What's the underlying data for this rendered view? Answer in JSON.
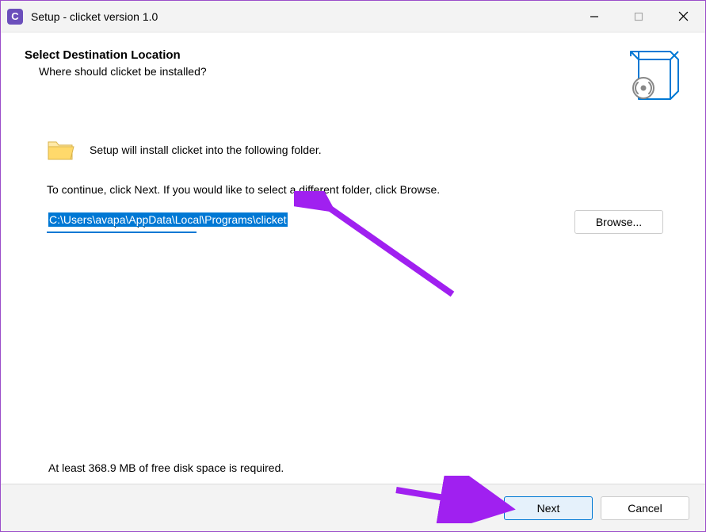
{
  "titlebar": {
    "icon_letter": "C",
    "title": "Setup - clicket version 1.0"
  },
  "header": {
    "title": "Select Destination Location",
    "subtitle": "Where should clicket be installed?"
  },
  "main": {
    "install_line": "Setup will install clicket into the following folder.",
    "continue_line": "To continue, click Next. If you would like to select a different folder, click Browse.",
    "path_value": "C:\\Users\\avapa\\AppData\\Local\\Programs\\clicket",
    "browse_label": "Browse...",
    "disk_space": "At least 368.9 MB of free disk space is required."
  },
  "footer": {
    "next": "Next",
    "cancel": "Cancel"
  }
}
